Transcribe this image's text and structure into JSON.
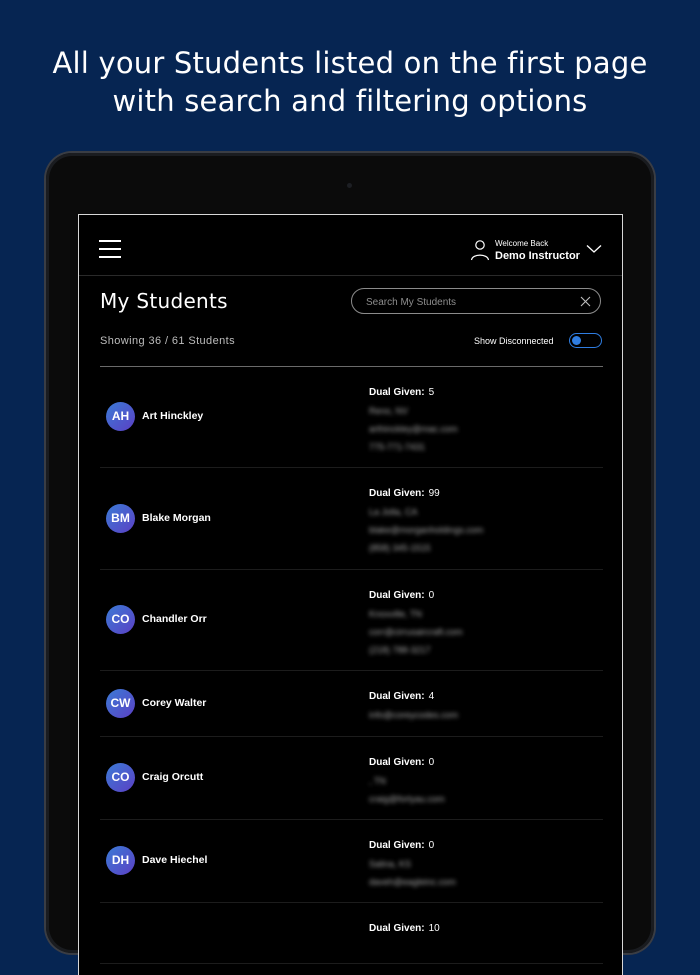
{
  "headline": {
    "line1": "All your Students listed on the first page",
    "line2": "with search and filtering options"
  },
  "header": {
    "welcome": "Welcome Back",
    "user_name": "Demo Instructor"
  },
  "main": {
    "title": "My Students",
    "search_placeholder": "Search My Students",
    "showing_text": "Showing 36 / 61 Students",
    "show_disconnected_label": "Show Disconnected",
    "show_disconnected_on": true
  },
  "colors": {
    "background": "#062552",
    "accent": "#2f7de1",
    "screen": "#000000"
  },
  "students": [
    {
      "initials": "AH",
      "name": "Art Hinckley",
      "dual_label": "Dual Given:",
      "dual": "5",
      "lines": [
        "Reno, NV",
        "arthinckley@mac.com",
        "775-771-7431"
      ]
    },
    {
      "initials": "BM",
      "name": "Blake Morgan",
      "dual_label": "Dual Given:",
      "dual": "99",
      "lines": [
        "La Jolla, CA",
        "blake@morganholdings.com",
        "(858) 345-1515"
      ]
    },
    {
      "initials": "CO",
      "name": "Chandler Orr",
      "dual_label": "Dual Given:",
      "dual": "0",
      "lines": [
        "Knoxville, TN",
        "corr@cirrusaircraft.com",
        "(218) 788-3217"
      ]
    },
    {
      "initials": "CW",
      "name": "Corey Walter",
      "dual_label": "Dual Given:",
      "dual": "4",
      "lines": [
        "info@coreycodes.com"
      ]
    },
    {
      "initials": "CO",
      "name": "Craig Orcutt",
      "dual_label": "Dual Given:",
      "dual": "0",
      "lines": [
        ", TN",
        "craig@fortyau.com"
      ]
    },
    {
      "initials": "DH",
      "name": "Dave Hiechel",
      "dual_label": "Dual Given:",
      "dual": "0",
      "lines": [
        "Salina, KS",
        "daveh@eagleinc.com"
      ]
    },
    {
      "initials": "",
      "name": "",
      "dual_label": "Dual Given:",
      "dual": "10",
      "lines": []
    }
  ]
}
